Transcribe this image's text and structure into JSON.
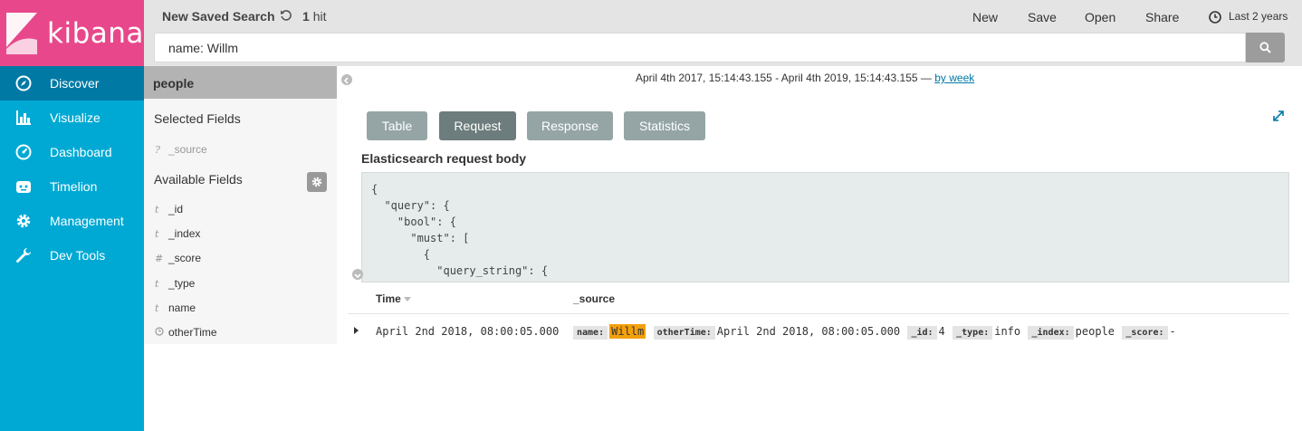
{
  "app": {
    "logo_text": "kibana",
    "brand_color": "#e8488b",
    "nav_color": "#00a9d4"
  },
  "nav": {
    "items": [
      {
        "label": "Discover",
        "icon": "compass-icon",
        "active": true
      },
      {
        "label": "Visualize",
        "icon": "bar-chart-icon"
      },
      {
        "label": "Dashboard",
        "icon": "dashboard-icon"
      },
      {
        "label": "Timelion",
        "icon": "timelion-icon"
      },
      {
        "label": "Management",
        "icon": "gear-icon"
      },
      {
        "label": "Dev Tools",
        "icon": "wrench-icon"
      }
    ]
  },
  "topbar": {
    "title": "New Saved Search",
    "hit_count": "1",
    "hit_label": "hit",
    "menu": {
      "new": "New",
      "save": "Save",
      "open": "Open",
      "share": "Share"
    },
    "time_range": "Last 2 years"
  },
  "search": {
    "query": "name: Willm"
  },
  "sidebar": {
    "index": "people",
    "selected_title": "Selected Fields",
    "selected": [
      {
        "type": "?",
        "name": "_source"
      }
    ],
    "available_title": "Available Fields",
    "available": [
      {
        "type": "t",
        "name": "_id"
      },
      {
        "type": "t",
        "name": "_index"
      },
      {
        "type": "#",
        "name": "_score"
      },
      {
        "type": "t",
        "name": "_type"
      },
      {
        "type": "t",
        "name": "name"
      },
      {
        "type": "clock",
        "name": "otherTime"
      }
    ]
  },
  "main": {
    "date_range": "April 4th 2017, 15:14:43.155 - April 4th 2019, 15:14:43.155 —",
    "interval_link": "by week",
    "tabs": [
      "Table",
      "Request",
      "Response",
      "Statistics"
    ],
    "active_tab": "Request",
    "request_title": "Elasticsearch request body",
    "request_body": "{\n  \"query\": {\n    \"bool\": {\n      \"must\": [\n        {\n          \"query_string\": {\n            \"query\": \"name: Willm\","
  },
  "table": {
    "headers": {
      "time": "Time",
      "source": "_source"
    },
    "rows": [
      {
        "time": "April 2nd 2018, 08:00:05.000",
        "source": [
          {
            "key": "name:",
            "value": "Willm",
            "highlight": true
          },
          {
            "key": "otherTime:",
            "value": "April 2nd 2018, 08:00:05.000"
          },
          {
            "key": "_id:",
            "value": "4"
          },
          {
            "key": "_type:",
            "value": "info"
          },
          {
            "key": "_index:",
            "value": "people"
          },
          {
            "key": "_score:",
            "value": "-"
          }
        ]
      }
    ]
  }
}
